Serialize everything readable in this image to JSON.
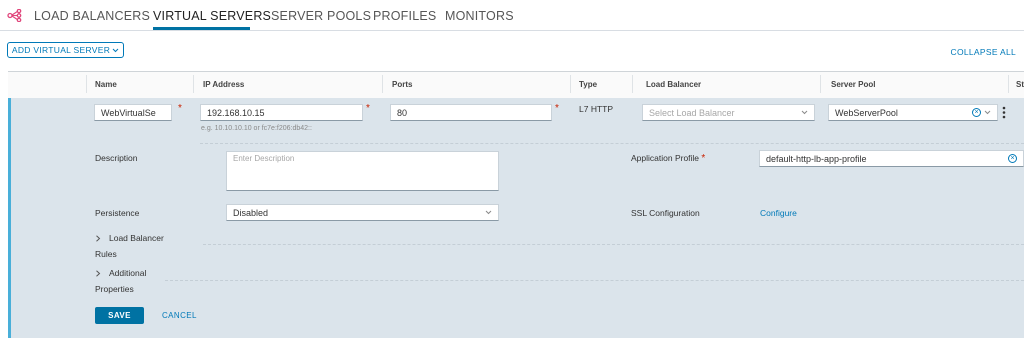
{
  "nav": {
    "tabs": [
      {
        "label": "LOAD BALANCERS"
      },
      {
        "label": "VIRTUAL SERVERS"
      },
      {
        "label": "SERVER POOLS"
      },
      {
        "label": "PROFILES"
      },
      {
        "label": "MONITORS"
      }
    ],
    "active_tab": "VIRTUAL SERVERS"
  },
  "toolbar": {
    "add_label": "ADD VIRTUAL SERVER",
    "add_icon": "chevron-down-icon",
    "collapse_label": "COLLAPSE ALL"
  },
  "table": {
    "columns": [
      "Name",
      "IP Address",
      "Ports",
      "Type",
      "Load Balancer",
      "Server Pool",
      "St"
    ]
  },
  "row": {
    "name_value": "WebVirtualSe",
    "ip_value": "192.168.10.15",
    "ip_hint": "e.g. 10.10.10.10 or fc7e:f206:db42::",
    "ports_value": "80",
    "type_value": "L7 HTTP",
    "load_balancer_placeholder": "Select Load Balancer",
    "server_pool_value": "WebServerPool",
    "required_marker": "*"
  },
  "details": {
    "description_label": "Description",
    "description_placeholder": "Enter Description",
    "app_profile_label": "Application Profile",
    "app_profile_value": "default-http-lb-app-profile",
    "persistence_label": "Persistence",
    "persistence_value": "Disabled",
    "ssl_label": "SSL Configuration",
    "ssl_link": "Configure",
    "lb_rules_label_1": "Load Balancer",
    "lb_rules_label_2": "Rules",
    "additional_label_1": "Additional",
    "additional_label_2": "Properties"
  },
  "actions": {
    "save_label": "SAVE",
    "cancel_label": "CANCEL"
  },
  "colors": {
    "accent": "#0072a3",
    "link": "#0079b8",
    "required": "#c92100",
    "row_bg": "#dbe4eb",
    "nav_icon": "#e0457b"
  }
}
